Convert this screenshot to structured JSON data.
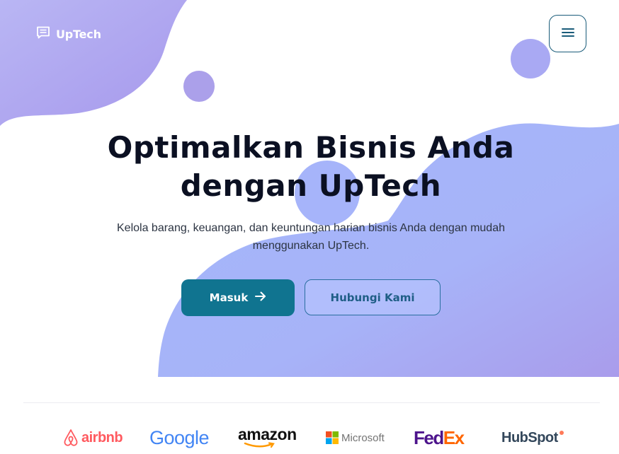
{
  "brand": {
    "name": "UpTech",
    "icon": "message-square-icon"
  },
  "nav": {
    "menu_icon": "hamburger-menu-icon"
  },
  "hero": {
    "title_line1": "Optimalkan Bisnis Anda",
    "title_line2": "dengan UpTech",
    "subtitle_line1": "Kelola barang, keuangan, dan keuntungan harian bisnis Anda dengan mudah",
    "subtitle_line2": "menggunakan UpTech.",
    "primary_button": "Masuk",
    "primary_button_icon": "arrow-right-icon",
    "secondary_button": "Hubungi Kami"
  },
  "partners": {
    "airbnb": "airbnb",
    "google": "Google",
    "amazon": "amazon",
    "microsoft": "Microsoft",
    "fedex_fed": "Fed",
    "fedex_ex": "Ex",
    "hubspot": "HubSpot"
  },
  "colors": {
    "primary": "#107490",
    "title": "#0b1022",
    "blob_purple": "#a99bee",
    "blob_blue": "#a6b8fb"
  }
}
